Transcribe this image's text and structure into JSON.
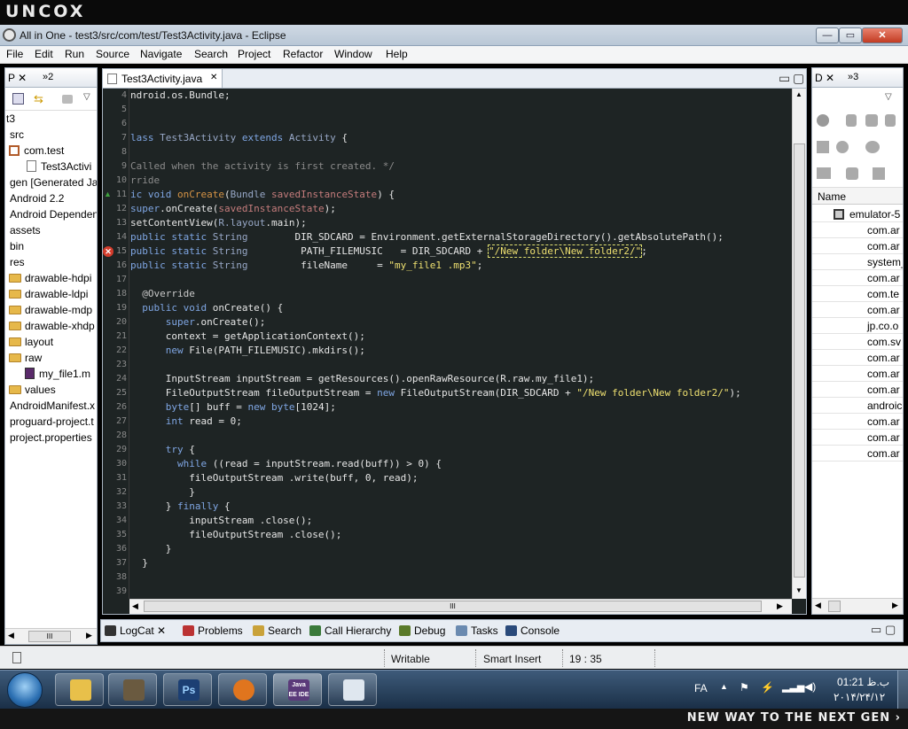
{
  "brand": {
    "logo": "UNCOX",
    "tagline": "NEW WAY TO THE NEXT GEN ›"
  },
  "window": {
    "title": "All in One - test3/src/com/test/Test3Activity.java - Eclipse",
    "min": "—",
    "max": "▭",
    "close": "✕"
  },
  "menu": [
    "File",
    "Edit",
    "Run",
    "Source",
    "Navigate",
    "Search",
    "Project",
    "Refactor",
    "Window",
    "Help"
  ],
  "explorer": {
    "tab_label": "P ✕",
    "tab_more": "»2",
    "items": [
      "t3",
      "src",
      "com.test",
      "Test3Activi",
      "gen [Generated Jav",
      "Android 2.2",
      "Android Dependen",
      "assets",
      "bin",
      "res",
      "drawable-hdpi",
      "drawable-ldpi",
      "drawable-mdp",
      "drawable-xhdp",
      "layout",
      "raw",
      "my_file1.m",
      "values",
      "AndroidManifest.x",
      "proguard-project.t",
      "project.properties"
    ],
    "hscroll_thumb": "III"
  },
  "editor": {
    "tab_label": "Test3Activity.java",
    "tab_close": "✕",
    "line_numbers": [
      "4",
      "5",
      "6",
      "7",
      "8",
      "9",
      "10",
      "11",
      "12",
      "13",
      "14",
      "15",
      "16",
      "17",
      "18",
      "19",
      "20",
      "21",
      "22",
      "23",
      "24",
      "25",
      "26",
      "27",
      "28",
      "29",
      "30",
      "31",
      "32",
      "33",
      "34",
      "35",
      "36",
      "37",
      "38",
      "39"
    ],
    "lines": {
      "l4": "ndroid.os.Bundle;",
      "l7a": "lass ",
      "l7b": "Test3Activity",
      "l7c": " extends ",
      "l7d": "Activity",
      "l7e": " {",
      "l9": "Called when the activity is first created. */",
      "l10": "rride",
      "l11a": "ic void ",
      "l11b": "onCreate",
      "l11c": "(",
      "l11d": "Bundle",
      "l11e": " ",
      "l11f": "savedInstanceState",
      "l11g": ") {",
      "l12a": "super",
      "l12b": ".onCreate(",
      "l12c": "savedInstanceState",
      "l12d": ");",
      "l13a": "setContentView(",
      "l13b": "R.layout",
      "l13c": ".main);",
      "l14a": "public static ",
      "l14b": "String",
      "l14c": "        DIR_SDCARD = Environment.getExternalStorageDirectory().getAbsolutePath();",
      "l15a": "public static ",
      "l15b": "String",
      "l15c": "         PATH_FILEMUSIC   = DIR_SDCARD + ",
      "l15d": "\"/New folder\\New folder2/\"",
      "l15e": ";",
      "l16a": "public static ",
      "l16b": "String",
      "l16c": "         fileName     = ",
      "l16d": "\"my_file1 .mp3\"",
      "l16e": ";",
      "l18": "  @Override",
      "l19a": "  public void ",
      "l19b": "onCreate() {",
      "l20a": "      super",
      "l20b": ".onCreate();",
      "l21": "      context = getApplicationContext();",
      "l22a": "      new ",
      "l22b": "File(PATH_FILEMUSIC).mkdirs();",
      "l24": "      InputStream inputStream = getResources().openRawResource(R.raw.my_file1);",
      "l25a": "      FileOutputStream fileOutputStream = ",
      "l25b": "new ",
      "l25c": "FileOutputStream(DIR_SDCARD + ",
      "l25d": "\"/New folder\\New folder2/\"",
      "l25e": ");",
      "l26a": "      byte",
      "l26b": "[] buff = ",
      "l26c": "new byte",
      "l26d": "[1024];",
      "l27a": "      int ",
      "l27b": "read = 0;",
      "l29a": "      try ",
      "l29b": "{",
      "l30a": "        while ",
      "l30b": "((read = inputStream.read(buff)) > 0) {",
      "l31": "          fileOutputStream .write(buff, 0, read);",
      "l32": "          }",
      "l33a": "      } ",
      "l33b": "finally ",
      "l33c": "{",
      "l34": "          inputStream .close();",
      "l35": "          fileOutputStream .close();",
      "l36": "      }",
      "l37": "  }"
    },
    "hscroll_thumb": "III"
  },
  "devices": {
    "tab_label": "D ✕",
    "tab_more": "»3",
    "column_header": "Name",
    "rows": [
      "emulator-5",
      "com.ar",
      "com.ar",
      "system_",
      "com.ar",
      "com.te",
      "com.ar",
      "jp.co.o",
      "com.sv",
      "com.ar",
      "com.ar",
      "com.ar",
      "androic",
      "com.ar",
      "com.ar",
      "com.ar"
    ]
  },
  "bottom_tabs": [
    "LogCat ✕",
    "Problems",
    "Search",
    "Call Hierarchy",
    "Debug",
    "Tasks",
    "Console"
  ],
  "status": {
    "mode": "Writable",
    "insert": "Smart Insert",
    "position": "19 : 35"
  },
  "taskbar": {
    "apps": [
      "",
      "",
      "Ps",
      "",
      "Java EE IDE",
      ""
    ],
    "lang": "FA",
    "time": "01:21 ب.ظ",
    "date": "۲۰۱۴/۲۴/۱۲"
  },
  "colors": {
    "editor_bg": "#1e2424",
    "keyword": "#7fa6e3",
    "string": "#eee070",
    "comment": "#8b8b8b",
    "method": "#d59345"
  }
}
